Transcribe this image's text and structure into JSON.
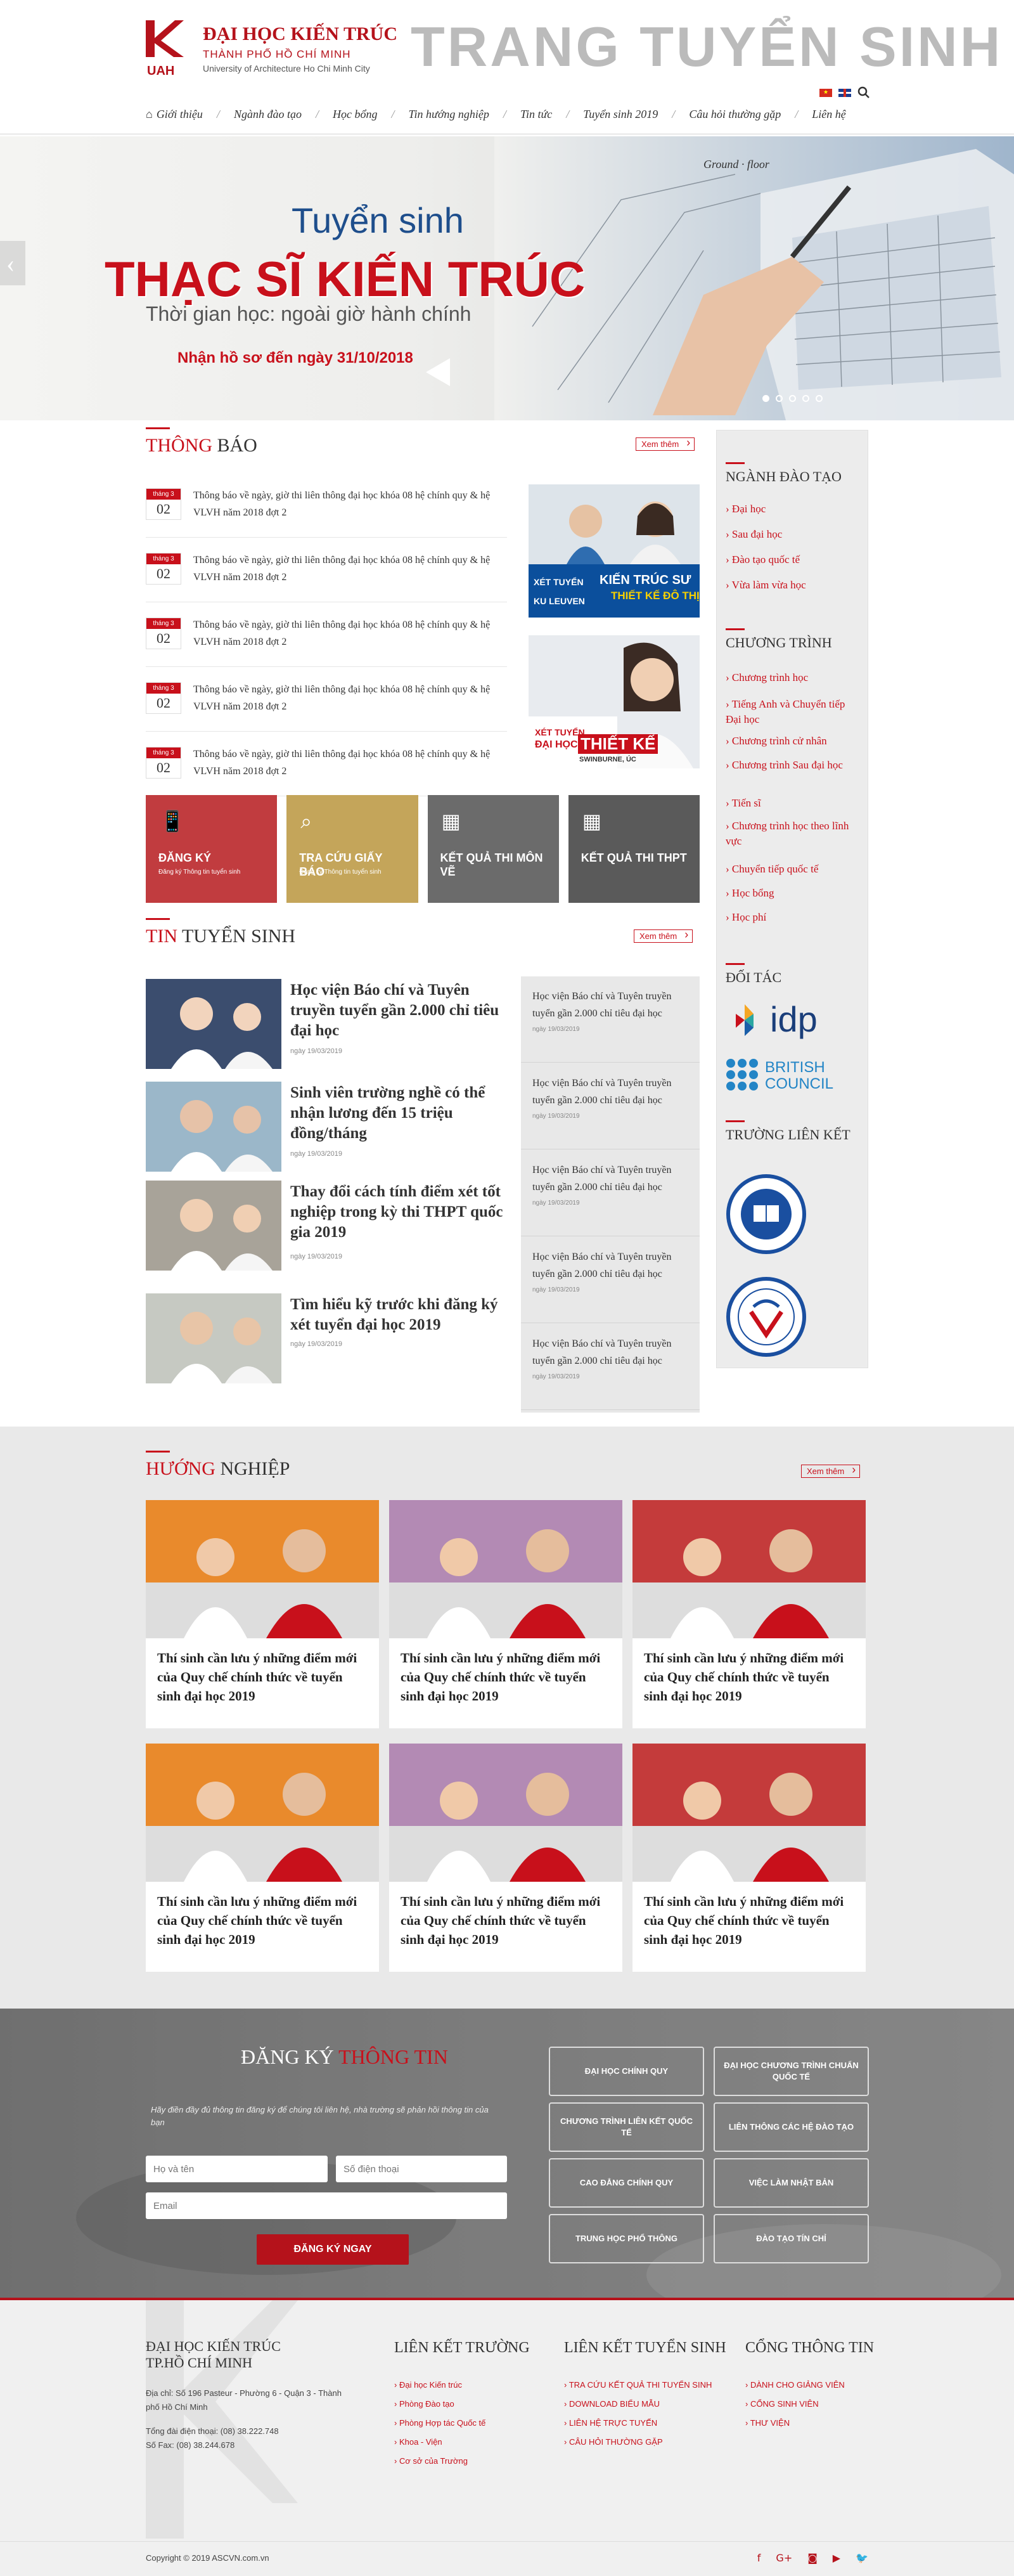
{
  "header": {
    "logo_text": "UAH",
    "university_name": "ĐẠI HỌC KIẾN TRÚC",
    "city": "THÀNH PHỐ HỒ CHÍ MINH",
    "english_name": "University of Architecture Ho Chi Minh City",
    "site_title": "TRANG TUYỂN SINH"
  },
  "nav": {
    "items": [
      {
        "label": "Giới thiệu",
        "icon": "home-icon"
      },
      {
        "label": "Ngành đào tạo"
      },
      {
        "label": "Học bổng"
      },
      {
        "label": "Tin hướng nghiệp"
      },
      {
        "label": "Tin tức"
      },
      {
        "label": "Tuyển sinh 2019"
      },
      {
        "label": "Câu hỏi thường gặp"
      },
      {
        "label": "Liên hệ"
      }
    ]
  },
  "hero": {
    "line1": "Tuyển sinh",
    "line2": "THẠC SĨ KIẾN TRÚC",
    "line3": "Thời gian học: ngoài giờ hành chính",
    "line4": "Nhận hồ sơ đến ngày 31/10/2018",
    "slide_count": 5,
    "active_slide": 1
  },
  "notices": {
    "title_red": "THÔNG",
    "title_rest": " BÁO",
    "more": "Xem thêm",
    "items": [
      {
        "month": "tháng 3",
        "day": "02",
        "text": "Thông báo về ngày, giờ thi liên thông đại học khóa 08 hệ chính quy & hệ VLVH năm 2018 đợt 2"
      },
      {
        "month": "tháng 3",
        "day": "02",
        "text": "Thông báo về ngày, giờ thi liên thông đại học khóa 08 hệ chính quy & hệ VLVH năm 2018 đợt 2"
      },
      {
        "month": "tháng 3",
        "day": "02",
        "text": "Thông báo về ngày, giờ thi liên thông đại học khóa 08 hệ chính quy & hệ VLVH năm 2018 đợt 2"
      },
      {
        "month": "tháng 3",
        "day": "02",
        "text": "Thông báo về ngày, giờ thi liên thông đại học khóa 08 hệ chính quy & hệ VLVH năm 2018 đợt 2"
      },
      {
        "month": "tháng 3",
        "day": "02",
        "text": "Thông báo về ngày, giờ thi liên thông đại học khóa 08 hệ chính quy & hệ VLVH năm 2018 đợt 2"
      }
    ]
  },
  "ads": {
    "ad1_small": "XÉT TUYỂN",
    "ad1_big": "KIẾN TRÚC SƯ",
    "ad1_sub": "THIẾT KẾ ĐÔ THỊ",
    "ad1_org": "KU LEUVEN",
    "ad2_small": "XÉT TUYỂN",
    "ad2_org": "ĐẠI HỌC",
    "ad2_big": "THIẾT KẾ",
    "ad2_sub": "SWINBURNE, ÚC"
  },
  "tiles": [
    {
      "label": "ĐĂNG KÝ",
      "sub": "Đăng ký Thông tin tuyển sinh",
      "icon": "phone-icon",
      "color": "#c13c3f"
    },
    {
      "label": "TRA CỨU GIẤY BÁO",
      "sub": "Đăng ký Thông tin tuyển sinh",
      "icon": "search-icon",
      "color": "#c4a55a"
    },
    {
      "label": "KẾT QUẢ THI MÔN VẼ",
      "sub": "",
      "icon": "calendar-icon",
      "color": "#6b6b6b"
    },
    {
      "label": "KẾT QUẢ THI THPT",
      "sub": "",
      "icon": "calendar-icon",
      "color": "#5a5a5a"
    }
  ],
  "news": {
    "title_red": "TIN",
    "title_rest": " TUYỂN SINH",
    "more": "Xem thêm",
    "items": [
      {
        "title": "Học viện Báo chí và Tuyên truyền tuyển gần 2.000 chỉ tiêu đại học",
        "date": "ngày 19/03/2019"
      },
      {
        "title": "Sinh viên trường nghề có thể nhận lương đến 15 triệu đồng/tháng",
        "date": "ngày 19/03/2019"
      },
      {
        "title": "Thay đổi cách tính điểm xét tốt nghiệp trong kỳ thi THPT quốc gia 2019",
        "date": "ngày 19/03/2019"
      },
      {
        "title": "Tìm hiểu kỹ trước khi đăng ký xét tuyển đại học 2019",
        "date": "ngày 19/03/2019"
      }
    ],
    "side_items": [
      {
        "title": "Học viện Báo chí và Tuyên truyền tuyển gần 2.000 chỉ tiêu đại học",
        "date": "ngày 19/03/2019"
      },
      {
        "title": "Học viện Báo chí và Tuyên truyền tuyển gần 2.000 chỉ tiêu đại học",
        "date": "ngày 19/03/2019"
      },
      {
        "title": "Học viện Báo chí và Tuyên truyền tuyển gần 2.000 chỉ tiêu đại học",
        "date": "ngày 19/03/2019"
      },
      {
        "title": "Học viện Báo chí và Tuyên truyền tuyển gần 2.000 chỉ tiêu đại học",
        "date": "ngày 19/03/2019"
      },
      {
        "title": "Học viện Báo chí và Tuyên truyền tuyển gần 2.000 chỉ tiêu đại học",
        "date": "ngày 19/03/2019"
      }
    ]
  },
  "sidebar": {
    "training_title": "NGÀNH ĐÀO TẠO",
    "training": [
      "Đại học",
      "Sau đại học",
      "Đào tạo quốc tế",
      "Vừa làm vừa học"
    ],
    "programs_title": "CHƯƠNG TRÌNH",
    "programs": [
      "Chương trình học",
      "Tiếng Anh và Chuyển tiếp Đại học",
      "Chương trình cử nhân",
      "Chương trình Sau đại học",
      "Tiến sĩ",
      "Chương trình học theo lĩnh vực",
      "Chuyển tiếp quốc tế",
      "Học bổng",
      "Học phí"
    ],
    "partners_title": "ĐỐI TÁC",
    "partner1": "idp",
    "partner2_line1": "BRITISH",
    "partner2_line2": "COUNCIL",
    "linked_title": "TRƯỜNG LIÊN KẾT"
  },
  "careers": {
    "title_red": "HƯỚNG",
    "title_rest": " NGHIỆP",
    "more": "Xem thêm",
    "items": [
      {
        "title": "Thí sinh cần lưu ý những điểm mới của Quy chế chính thức về tuyển sinh đại học 2019"
      },
      {
        "title": "Thí sinh cần lưu ý những điểm mới của Quy chế chính thức về tuyển sinh đại học 2019"
      },
      {
        "title": "Thí sinh cần lưu ý những điểm mới của Quy chế chính thức về tuyển sinh đại học 2019"
      },
      {
        "title": "Thí sinh cần lưu ý những điểm mới của Quy chế chính thức về tuyển sinh đại học 2019"
      },
      {
        "title": "Thí sinh cần lưu ý những điểm mới của Quy chế chính thức về tuyển sinh đại học 2019"
      },
      {
        "title": "Thí sinh cần lưu ý những điểm mới của Quy chế chính thức về tuyển sinh đại học 2019"
      }
    ]
  },
  "register": {
    "title_white": "ĐĂNG KÝ ",
    "title_red": "THÔNG TIN",
    "desc": "Hãy điền đầy đủ thông tin đăng ký để chúng tôi liên hệ, nhà trường sẽ phản hồi thông tin của bạn",
    "name_placeholder": "Họ và tên",
    "phone_placeholder": "Số điện thoại",
    "email_placeholder": "Email",
    "submit": "ĐĂNG KÝ NGAY",
    "links": [
      "ĐẠI HỌC CHÍNH QUY",
      "ĐẠI HỌC CHƯƠNG TRÌNH CHUẨN QUỐC TẾ",
      "CHƯƠNG TRÌNH LIÊN KẾT QUỐC TẾ",
      "LIÊN THÔNG CÁC HỆ ĐÀO TẠO",
      "CAO ĐẲNG CHÍNH QUY",
      "VIỆC LÀM NHẬT BẢN",
      "TRUNG HỌC PHỔ THÔNG",
      "ĐÀO TẠO TÍN CHỈ"
    ]
  },
  "footer": {
    "col1_title_line1": "ĐẠI HỌC KIẾN TRÚC",
    "col1_title_line2": "TP.HỒ CHÍ MINH",
    "address": "Địa chỉ: Số 196 Pasteur - Phường 6 - Quận 3 - Thành phố Hồ Chí Minh",
    "phone": "Tổng đài điện thoại: (08) 38.222.748",
    "fax": "Số Fax: (08) 38.244.678",
    "col2_title": "LIÊN KẾT TRƯỜNG",
    "col2_links": [
      "Đại học Kiến trúc",
      "Phòng Đào tạo",
      "Phòng Hợp tác Quốc tế",
      "Khoa - Viện",
      "Cơ sở của Trường"
    ],
    "col3_title": "LIÊN KẾT TUYỂN SINH",
    "col3_links": [
      "TRA CỨU KẾT QUẢ THI TUYỂN SINH",
      "DOWNLOAD BIỂU MẪU",
      "LIÊN HỆ TRỰC TUYẾN",
      "CÂU HỎI THƯỜNG GẶP"
    ],
    "col4_title": "CỔNG THÔNG TIN",
    "col4_links": [
      "DÀNH CHO GIẢNG VIÊN",
      "CỔNG SINH VIÊN",
      "THƯ VIỆN"
    ],
    "copyright": "Copyright © 2019 ASCVN.com.vn"
  }
}
